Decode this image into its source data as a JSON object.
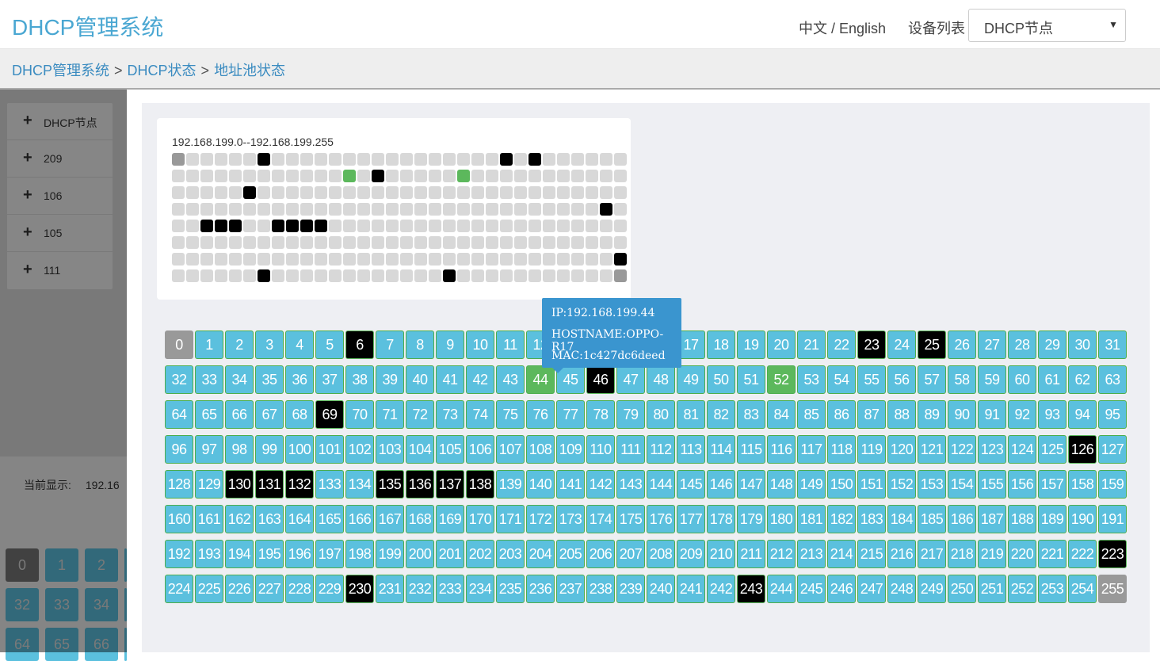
{
  "header": {
    "app_title": "DHCP管理系统",
    "language_toggle": "中文 / English",
    "device_list_label": "设备列表",
    "device_select_value": "DHCP节点"
  },
  "breadcrumb": {
    "items": [
      "DHCP管理系统",
      "DHCP状态",
      "地址池状态"
    ],
    "separator": ">"
  },
  "sidebar": {
    "items": [
      {
        "label": "DHCP节点"
      },
      {
        "label": "209"
      },
      {
        "label": "106"
      },
      {
        "label": "105"
      },
      {
        "label": "111"
      }
    ]
  },
  "background_page": {
    "current_display_label": "当前显示:",
    "current_display_value": "192.16",
    "visible_cells": [
      "0",
      "1",
      "2",
      "32",
      "33",
      "34",
      "64",
      "65",
      "66"
    ]
  },
  "pool": {
    "range_label": "192.168.199.0--192.168.199.255",
    "total_addresses": 256,
    "reserved": [
      0,
      255
    ],
    "used": [
      6,
      23,
      25,
      46,
      69,
      126,
      130,
      131,
      132,
      135,
      136,
      137,
      138,
      223,
      230,
      243
    ],
    "online": [
      44,
      52
    ],
    "status_colors": {
      "free_mini": "#d8d8d8",
      "free": "#5bc0de",
      "used": "#000000",
      "reserved": "#999999",
      "online": "#5cb85c"
    }
  },
  "tooltip": {
    "ip": "IP:192.168.199.44",
    "hostname": "HOSTNAME:OPPO-R17",
    "mac": "MAC:1c427dc6deed"
  }
}
